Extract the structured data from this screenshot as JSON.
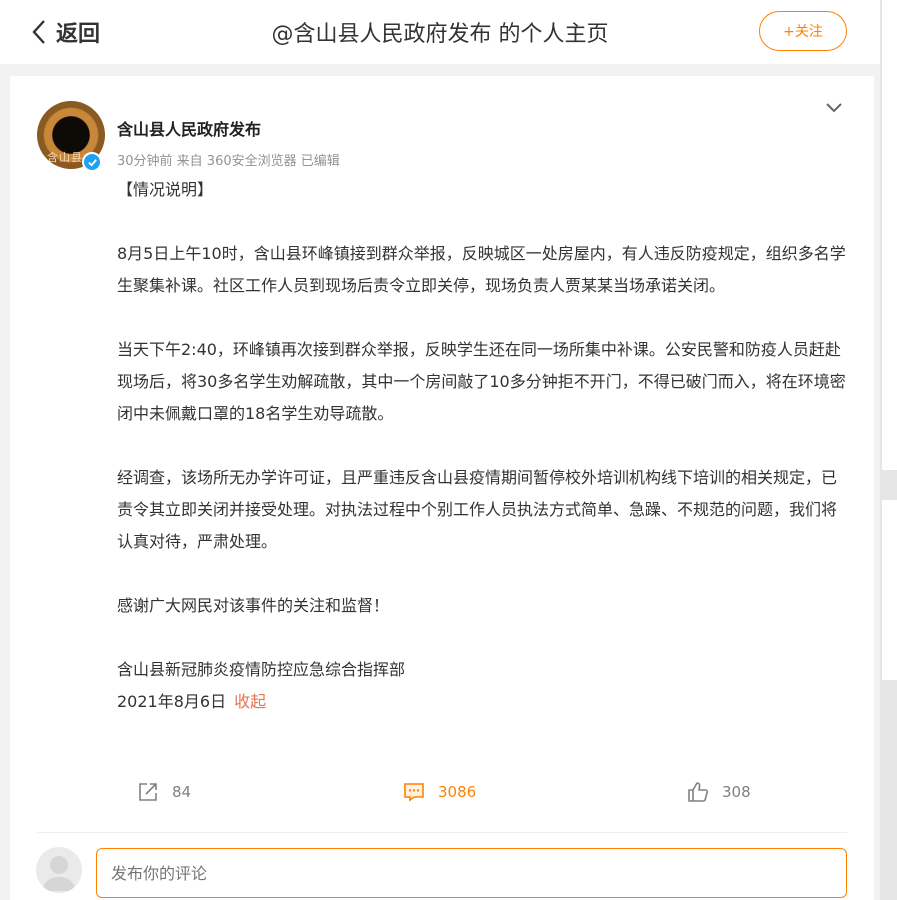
{
  "header": {
    "back_label": "返回",
    "title": "@含山县人民政府发布 的个人主页",
    "follow_label": "+关注"
  },
  "post": {
    "author": "含山县人民政府发布",
    "avatar_text": "含山县",
    "meta": "30分钟前  来自 360安全浏览器  已编辑",
    "paragraphs": [
      "【情况说明】",
      "8月5日上午10时，含山县环峰镇接到群众举报，反映城区一处房屋内，有人违反防疫规定，组织多名学生聚集补课。社区工作人员到现场后责令立即关停，现场负责人贾某某当场承诺关闭。",
      "当天下午2:40，环峰镇再次接到群众举报，反映学生还在同一场所集中补课。公安民警和防疫人员赶赴现场后，将30多名学生劝解疏散，其中一个房间敲了10多分钟拒不开门，不得已破门而入，将在环境密闭中未佩戴口罩的18名学生劝导疏散。",
      "经调查，该场所无办学许可证，且严重违反含山县疫情期间暂停校外培训机构线下培训的相关规定，已责令其立即关闭并接受处理。对执法过程中个别工作人员执法方式简单、急躁、不规范的问题，我们将认真对待，严肃处理。",
      "感谢广大网民对该事件的关注和监督！",
      "含山县新冠肺炎疫情防控应急综合指挥部"
    ],
    "date": "2021年8月6日",
    "collapse_label": "收起"
  },
  "actions": {
    "repost_count": "84",
    "comment_count": "3086",
    "like_count": "308"
  },
  "comment_box": {
    "placeholder": "发布你的评论"
  },
  "colors": {
    "accent": "#ff8200",
    "link": "#eb7350",
    "verified": "#1da1f2"
  }
}
